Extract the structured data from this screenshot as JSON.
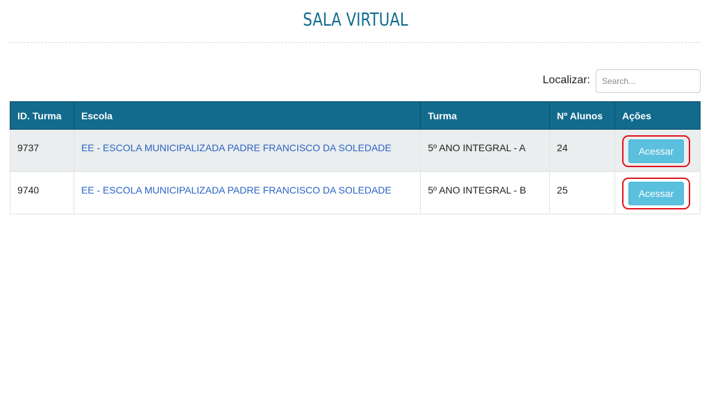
{
  "header": {
    "title": "SALA VIRTUAL"
  },
  "search": {
    "label": "Localizar:",
    "placeholder": "Search...",
    "value": ""
  },
  "table": {
    "columns": [
      "ID. Turma",
      "Escola",
      "Turma",
      "Nº Alunos",
      "Ações"
    ],
    "rows": [
      {
        "id": "9737",
        "escola": "EE - ESCOLA MUNICIPALIZADA PADRE FRANCISCO DA SOLEDADE",
        "turma": "5º ANO INTEGRAL - A",
        "alunos": "24",
        "action": "Acessar"
      },
      {
        "id": "9740",
        "escola": "EE - ESCOLA MUNICIPALIZADA PADRE FRANCISCO DA SOLEDADE",
        "turma": "5º ANO INTEGRAL - B",
        "alunos": "25",
        "action": "Acessar"
      }
    ]
  },
  "colors": {
    "title": "#126e8f",
    "header_bg": "#126a8c",
    "link": "#2a63c4",
    "button": "#5bc0de",
    "highlight": "#e0141e"
  }
}
